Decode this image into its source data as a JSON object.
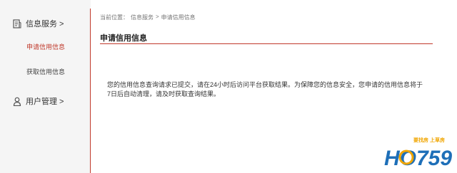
{
  "sidebar": {
    "service_group": {
      "label": "信息服务 >",
      "icon": "document-icon"
    },
    "items": [
      {
        "label": "申请信用信息",
        "active": true
      },
      {
        "label": "获取信用信息",
        "active": false
      }
    ],
    "user_group": {
      "label": "用户管理 >",
      "icon": "user-icon"
    }
  },
  "breadcrumb": {
    "prefix": "当前位置：",
    "level1": "信息服务",
    "sep": ">",
    "level2": "申请信用信息"
  },
  "main": {
    "title": "申请信用信息",
    "message": "您的信用信息查询请求已提交，请在24小时后访问平台获取结果。为保障您的信息安全，您申请的信用信息将于7日后自动清理，请及时获取查询结果。"
  },
  "watermark": {
    "slogan": "要找房 上草房",
    "logo_text": "HO759"
  },
  "colors": {
    "accent": "#c0392b",
    "sidebar_bg": "#f5f5f5",
    "logo_blue": "#1e6fb8",
    "logo_orange": "#f0a500"
  }
}
